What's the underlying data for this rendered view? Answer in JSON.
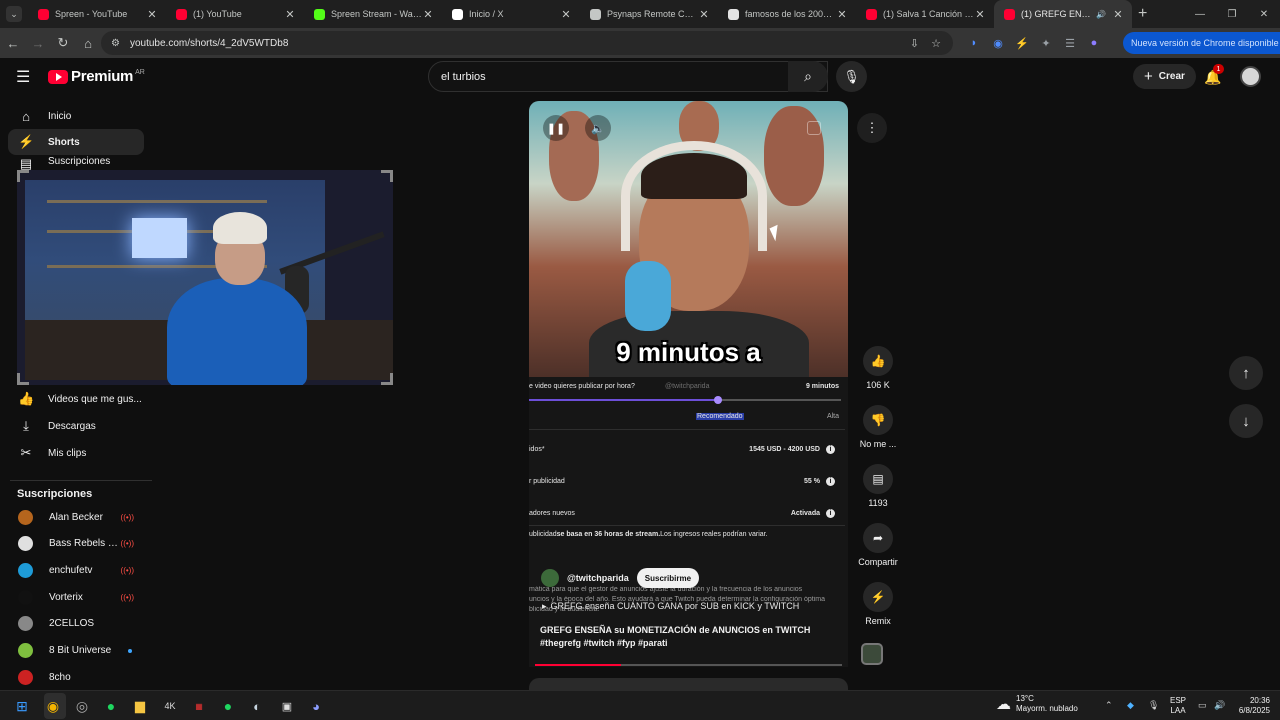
{
  "browser": {
    "tabs": [
      {
        "title": "Spreen - YouTube",
        "favicon_color": "#ff0033",
        "active": false
      },
      {
        "title": "(1) YouTube",
        "favicon_color": "#ff0033",
        "active": false
      },
      {
        "title": "Spreen Stream - Watch Li",
        "favicon_color": "#53fc18",
        "active": false
      },
      {
        "title": "Inicio / X",
        "favicon_color": "#ffffff",
        "active": false
      },
      {
        "title": "Psynaps Remote Control",
        "favicon_color": "#c4c7c5",
        "active": false
      },
      {
        "title": "famosos de los 2000 - Bu",
        "favicon_color": "#e3e3e3",
        "active": false
      },
      {
        "title": "(1) Salva 1 Canción por C",
        "favicon_color": "#ff0033",
        "active": false
      },
      {
        "title": "(1) GREFG ENSEÑA su",
        "favicon_color": "#ff0033",
        "active": true
      }
    ],
    "url": "youtube.com/shorts/4_2dV5WTDb8",
    "update_button": "Nueva versión de Chrome disponible"
  },
  "header": {
    "logo_text": "Premium",
    "country_code": "AR",
    "search_value": "el turbios",
    "create_label": "Crear",
    "notification_count": "1"
  },
  "sidebar": {
    "items": [
      {
        "label": "Inicio",
        "icon": "home-icon"
      },
      {
        "label": "Shorts",
        "icon": "shorts-icon"
      },
      {
        "label": "Suscripciones",
        "icon": "subscriptions-icon"
      },
      {
        "label": "Videos que me gus...",
        "icon": "like-icon"
      },
      {
        "label": "Descargas",
        "icon": "download-icon"
      },
      {
        "label": "Mis clips",
        "icon": "scissors-icon"
      }
    ],
    "subscriptions_heading": "Suscripciones",
    "subscriptions": [
      {
        "name": "Alan Becker",
        "live": true,
        "avatar_color": "#b5651d"
      },
      {
        "name": "Bass Rebels - Co...",
        "live": true,
        "avatar_color": "#e0e0e0"
      },
      {
        "name": "enchufetv",
        "live": true,
        "avatar_color": "#1e9bd7"
      },
      {
        "name": "Vorterix",
        "live": true,
        "avatar_color": "#111111"
      },
      {
        "name": "2CELLOS",
        "live": false,
        "avatar_color": "#888888"
      },
      {
        "name": "8 Bit Universe",
        "live": false,
        "new": true,
        "avatar_color": "#7fbf3f"
      },
      {
        "name": "8cho",
        "live": false,
        "avatar_color": "#cc2222"
      }
    ]
  },
  "short": {
    "caption": "9 minutos a",
    "watermark": "@twitchparida",
    "overlay_rows": {
      "question": "e video quieres publicar por hora?",
      "question_value": "9 minutos",
      "slider_label": "Recomendado",
      "slider_right": "Alta",
      "row1_label": "idos*",
      "row1_value": "1545 USD - 4200 USD",
      "row2_label": "r publicidad",
      "row2_value": "55 %",
      "row3_label": "adores nuevos",
      "row3_value": "Activada",
      "footnote_pre": "ublicidad ",
      "footnote_bold": "se basa en 36 horas de stream.",
      "footnote_post": " Los ingresos reales podrían variar."
    },
    "desc_line1": "mática  para que el gestor de anuncios ajuste la duración y la frecuencia de los anuncios",
    "desc_line2": "uncios y la época del año. Esto ayudará a que Twitch pueda determinar la configuración óptima",
    "desc_line3": "blicidad y la audiencia.",
    "channel": "@twitchparida",
    "subscribe_label": "Suscribirme",
    "linked_video": "GREFG enseña CUANTO GANA por SUB en KICK y TWITCH",
    "title": "GREFG ENSEÑA su MONETIZACIÓN de ANUNCIOS en TWITCH #thegrefg #twitch #fyp #parati",
    "progress": 0.28
  },
  "actions": {
    "likes": "106 K",
    "dislike_label": "No me ...",
    "comments": "1193",
    "share_label": "Compartir",
    "remix_label": "Remix"
  },
  "taskbar": {
    "weather_temp": "13°C",
    "weather_desc": "Mayorm. nublado",
    "lang_top": "ESP",
    "lang_bottom": "LAA",
    "time": "20:36",
    "date": "6/8/2025"
  }
}
